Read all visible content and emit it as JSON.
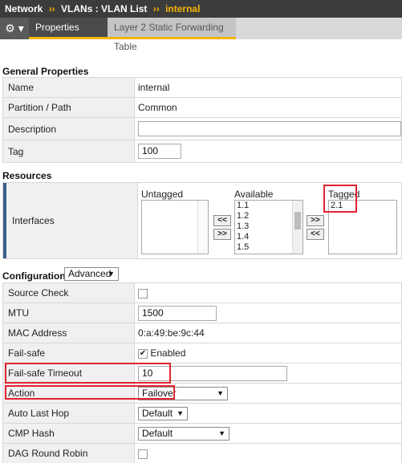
{
  "breadcrumb": {
    "root": "Network",
    "separator": "››",
    "middle": "VLANs : VLAN List",
    "current": "internal"
  },
  "tabs": {
    "gear": "⚙ ▾",
    "properties": "Properties",
    "l2_table": "Layer 2 Static Forwarding Table"
  },
  "general": {
    "title": "General Properties",
    "name_label": "Name",
    "name_value": "internal",
    "partition_label": "Partition / Path",
    "partition_value": "Common",
    "description_label": "Description",
    "description_value": "",
    "tag_label": "Tag",
    "tag_value": "100"
  },
  "resources": {
    "title": "Resources",
    "interfaces_label": "Interfaces",
    "untagged_label": "Untagged",
    "available_label": "Available",
    "tagged_label": "Tagged",
    "untagged_items": [],
    "available_items": [
      "1.1",
      "1.2",
      "1.3",
      "1.4",
      "1.5"
    ],
    "tagged_items": [
      "2.1"
    ],
    "btn_add": "<<",
    "btn_remove": ">>",
    "btn_add2": ">>",
    "btn_remove2": "<<"
  },
  "configuration": {
    "title": "Configuration:",
    "mode": "Advanced",
    "source_check_label": "Source Check",
    "mtu_label": "MTU",
    "mtu_value": "1500",
    "mac_label": "MAC Address",
    "mac_value": "0:a:49:be:9c:44",
    "failsafe_label": "Fail-safe",
    "failsafe_value": "Enabled",
    "failsafe_timeout_label": "Fail-safe Timeout",
    "failsafe_timeout_value": "10",
    "action_label": "Action",
    "action_value": "Failover",
    "auto_last_hop_label": "Auto Last Hop",
    "auto_last_hop_value": "Default",
    "cmp_hash_label": "CMP Hash",
    "cmp_hash_value": "Default",
    "dag_label": "DAG Round Robin"
  },
  "colors": {
    "highlight": "#e0232f",
    "accent": "#f5b400",
    "header": "#3c3c3c"
  }
}
